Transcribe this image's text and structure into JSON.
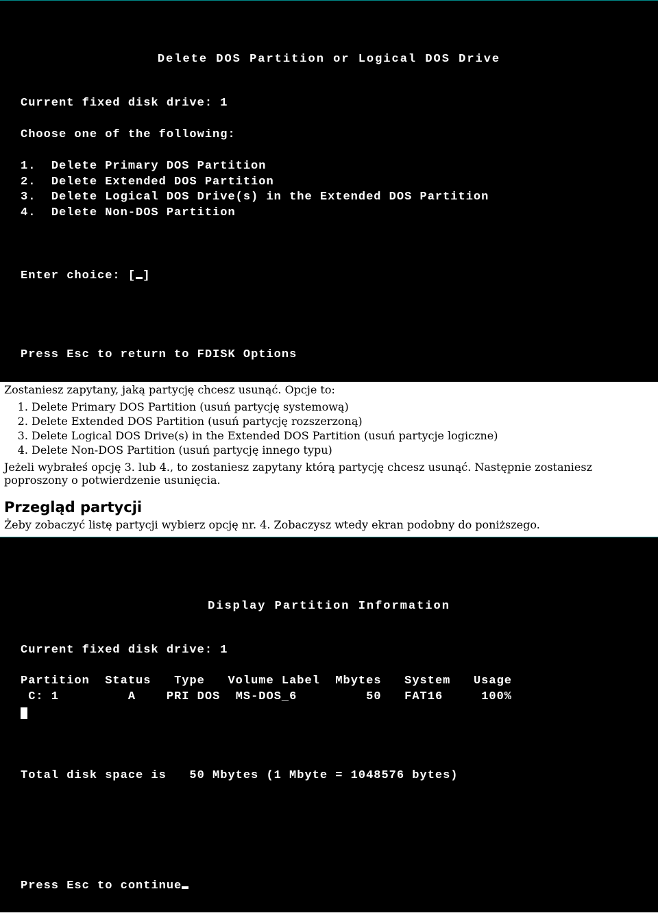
{
  "screen1": {
    "title": "Delete DOS Partition or Logical DOS Drive",
    "current_drive_label": "Current fixed disk drive:",
    "current_drive_value": "1",
    "choose_label": "Choose one of the following:",
    "options": [
      {
        "num": "1.",
        "text": "Delete Primary DOS Partition"
      },
      {
        "num": "2.",
        "text": "Delete Extended DOS Partition"
      },
      {
        "num": "3.",
        "text": "Delete Logical DOS Drive(s) in the Extended DOS Partition"
      },
      {
        "num": "4.",
        "text": "Delete Non-DOS Partition"
      }
    ],
    "enter_choice": "Enter choice: [ ]",
    "esc_line_a": "Press ",
    "esc_key": "Esc",
    "esc_line_b": " to return to FDISK Options"
  },
  "doc1": {
    "intro": "Zostaniesz zapytany, jaką partycję chcesz usunąć. Opcje to:",
    "items": [
      "Delete Primary DOS Partition (usuń partycję systemową)",
      "Delete Extended DOS Partition (usuń partycję rozszerzoną)",
      "Delete Logical DOS Drive(s) in the Extended DOS Partition (usuń partycje logiczne)",
      "Delete Non-DOS Partition (usuń partycję innego typu)"
    ],
    "after": "Jeżeli wybrałeś opcję 3. lub 4., to zostaniesz zapytany którą partycję chcesz usunąć. Następnie zostaniesz poproszony o potwierdzenie usunięcia."
  },
  "section2_title": "Przegląd partycji",
  "doc2": {
    "intro": "Żeby zobaczyć listę partycji wybierz opcję nr. 4. Zobaczysz wtedy ekran podobny do poniższego."
  },
  "screen2": {
    "title": "Display Partition Information",
    "current_drive_label": "Current fixed disk drive:",
    "current_drive_value": "1",
    "headers": {
      "partition": "Partition",
      "status": "Status",
      "type": "Type",
      "volume": "Volume Label",
      "mbytes": "Mbytes",
      "system": "System",
      "usage": "Usage"
    },
    "row": {
      "partition": " C: 1",
      "status": "A",
      "type": "PRI DOS",
      "volume": "MS-DOS_6",
      "mbytes": "50",
      "system": "FAT16",
      "usage": "100%"
    },
    "total_line": "Total disk space is   50 Mbytes (1 Mbyte = 1048576 bytes)",
    "esc_line_a": "Press ",
    "esc_key": "Esc",
    "esc_line_b": " to continue"
  }
}
